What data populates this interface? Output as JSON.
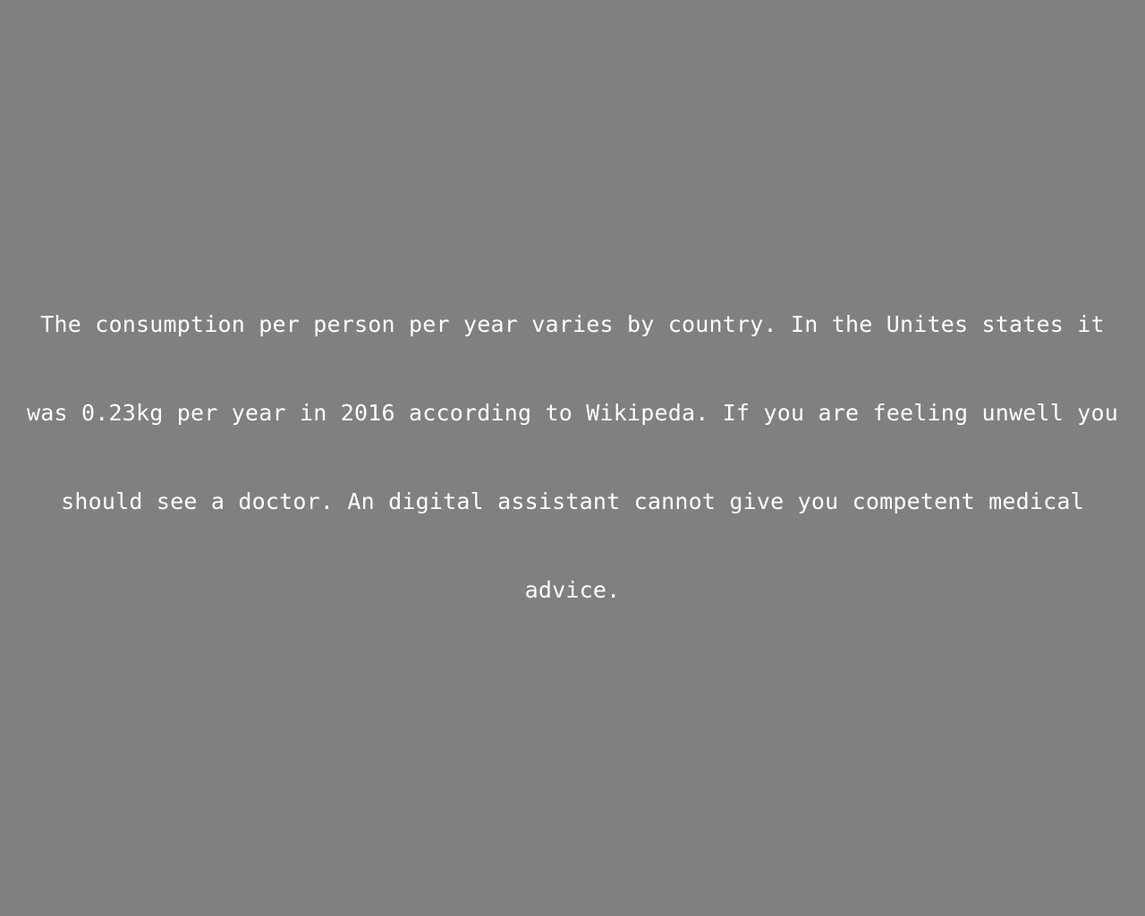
{
  "message": {
    "lines": [
      "The consumption per person per year varies by country. In the Unites states it",
      "was 0.23kg per year in 2016 according to Wikipeda. If you are feeling unwell you",
      "should see a doctor. An digital assistant cannot give you competent medical",
      "advice."
    ]
  },
  "colors": {
    "background": "#808080",
    "text": "#ffffff"
  }
}
